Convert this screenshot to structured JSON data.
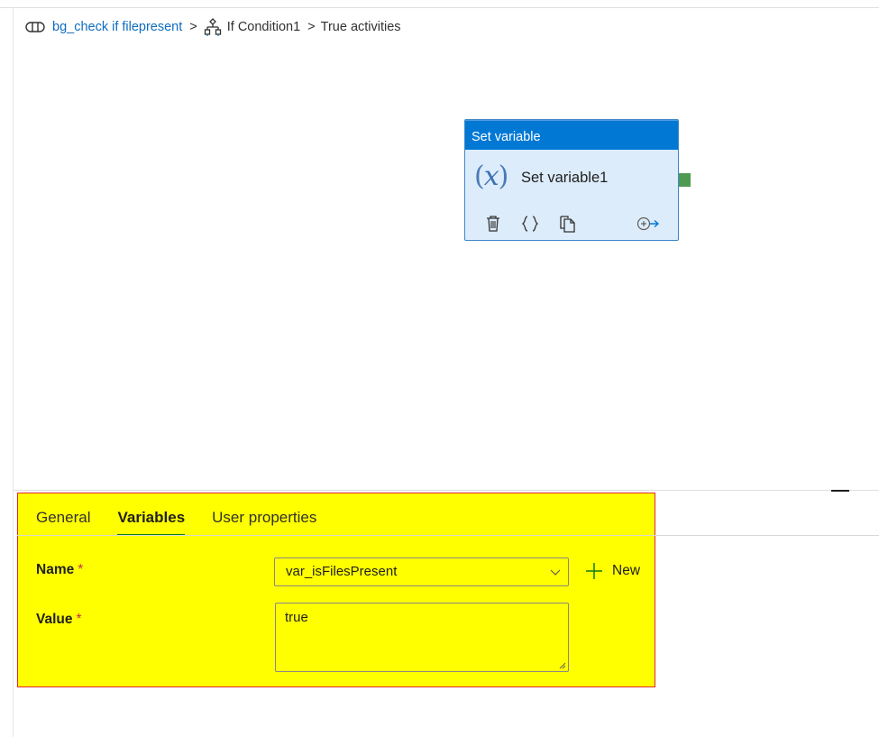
{
  "breadcrumb": {
    "pipeline": "bg_check if filepresent",
    "separator": ">",
    "activity": "If Condition1",
    "branch": "True activities",
    "pipeline_icon": "pipeline-icon",
    "activity_icon": "if-condition-icon"
  },
  "activity": {
    "type": "Set variable",
    "name": "Set variable1",
    "icon": "variable-x-icon",
    "icon_open": "(",
    "icon_symbol": "x",
    "icon_close": ")",
    "toolbar": [
      "delete-icon",
      "code-icon",
      "copy-icon",
      "add-output-icon"
    ]
  },
  "panel": {
    "tabs": [
      {
        "label": "General",
        "active": false
      },
      {
        "label": "Variables",
        "active": true
      },
      {
        "label": "User properties",
        "active": false
      }
    ],
    "name_label": "Name",
    "name_value": "var_isFilesPresent",
    "value_label": "Value",
    "value_value": "true",
    "required_mark": "*",
    "new_label": "New"
  },
  "colors": {
    "header_blue": "#0078d4",
    "node_fill": "#dcecfb",
    "link_blue": "#0f6cbd",
    "highlight": "#ffff00",
    "highlight_border": "#e22a2a",
    "tab_underline": "#107c10",
    "success_handle": "#4f9a53"
  }
}
